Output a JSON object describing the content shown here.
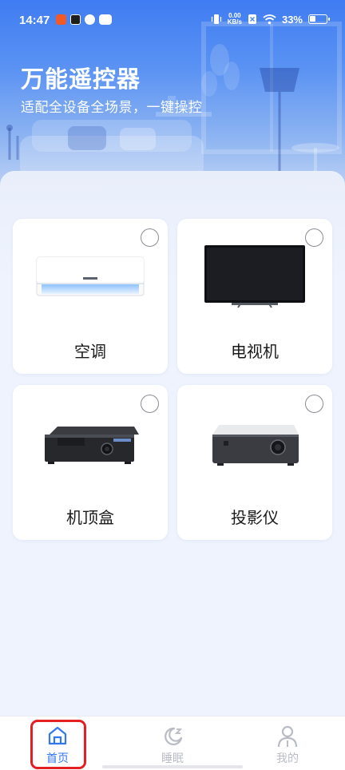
{
  "status_bar": {
    "time": "14:47",
    "speed_value": "0.00",
    "speed_unit": "KB/s",
    "battery": "33%",
    "notification_icons": [
      "app-orange-icon",
      "play-icon",
      "cloud-app-icon",
      "chat-app-icon"
    ]
  },
  "header": {
    "title": "万能遥控器",
    "subtitle": "适配全设备全场景，一键操控"
  },
  "devices": [
    {
      "label": "空调",
      "icon": "air-conditioner-icon",
      "selected": false
    },
    {
      "label": "电视机",
      "icon": "television-icon",
      "selected": false
    },
    {
      "label": "机顶盒",
      "icon": "set-top-box-icon",
      "selected": false
    },
    {
      "label": "投影仪",
      "icon": "projector-icon",
      "selected": false
    }
  ],
  "tabs": [
    {
      "label": "首页",
      "icon": "home-icon",
      "active": true
    },
    {
      "label": "睡眠",
      "icon": "moon-icon",
      "active": false
    },
    {
      "label": "我的",
      "icon": "person-icon",
      "active": false
    }
  ],
  "colors": {
    "accent": "#3476ef",
    "highlight": "#e3201f",
    "hero_top": "#3f7cf2"
  }
}
